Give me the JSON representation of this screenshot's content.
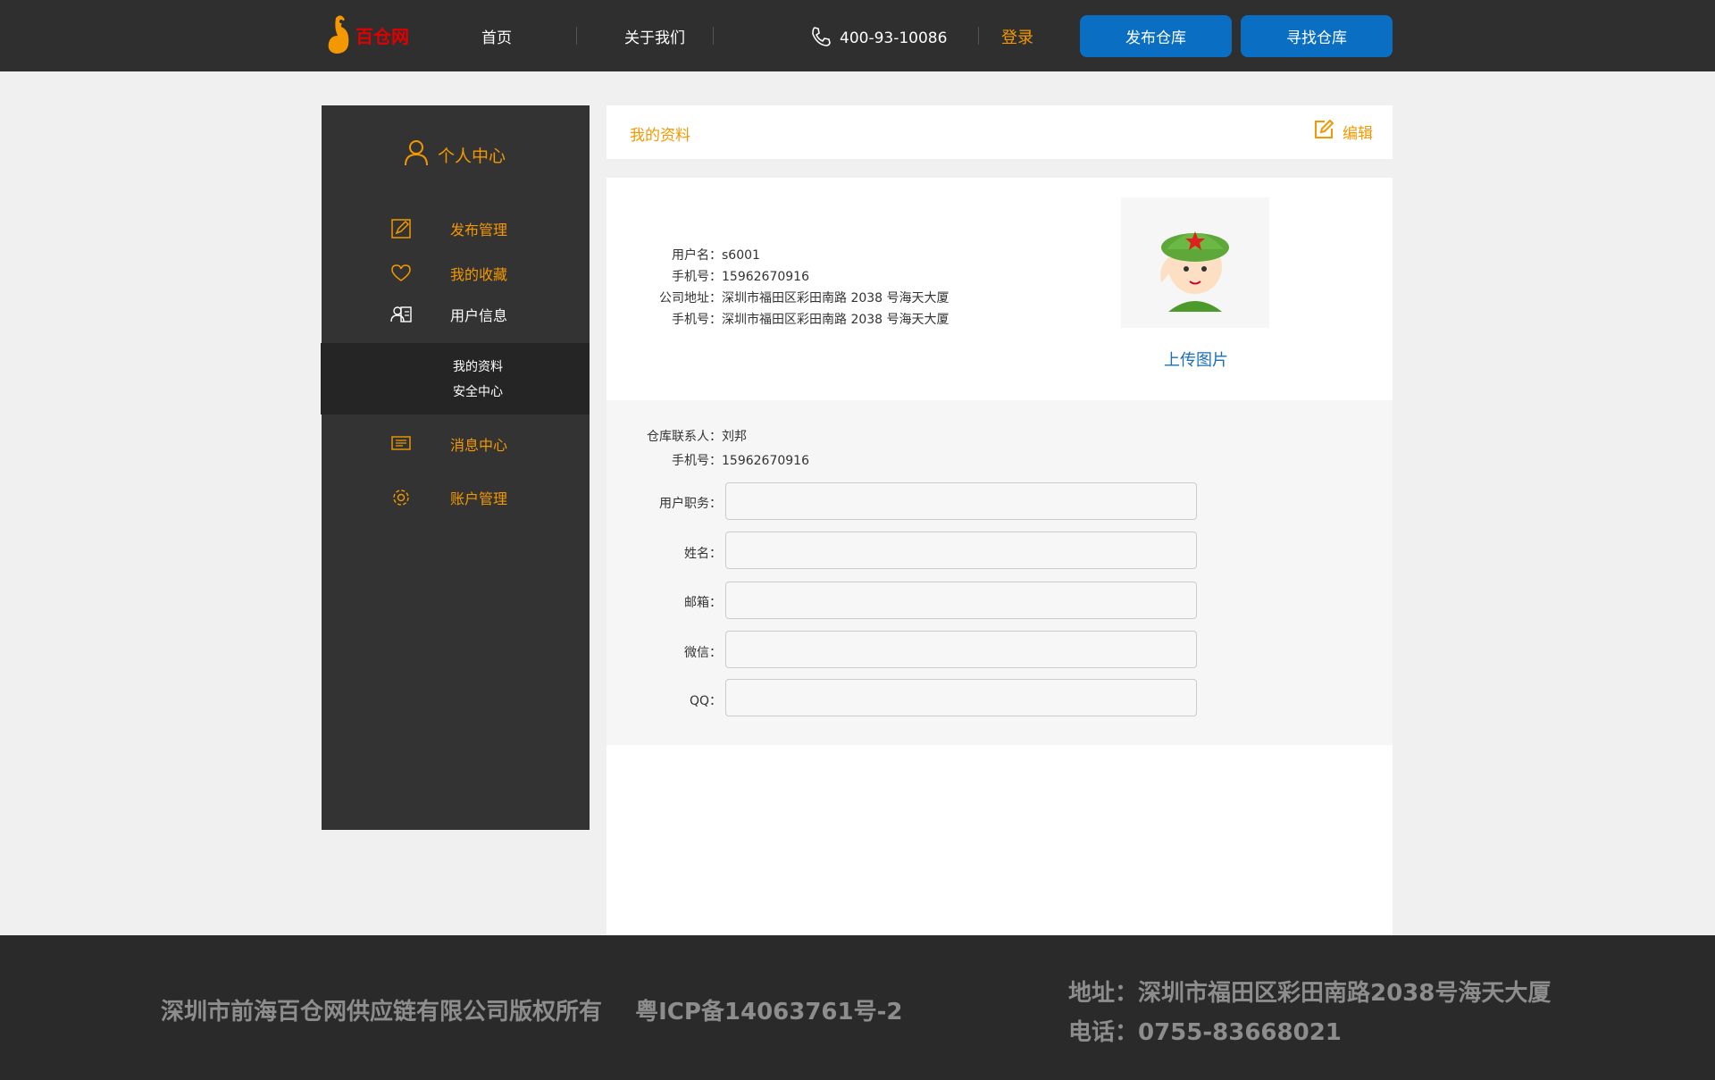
{
  "header": {
    "logo_text": "百仓网",
    "nav": [
      "首页",
      "关于我们"
    ],
    "phone": "400-93-10086",
    "login": "登录",
    "publish_button": "发布仓库",
    "find_button": "寻找仓库"
  },
  "sidebar": {
    "title": "个人中心",
    "items": [
      {
        "label": "发布管理",
        "icon": "edit-icon"
      },
      {
        "label": "我的收藏",
        "icon": "heart-icon"
      },
      {
        "label": "用户信息",
        "icon": "user-card-icon"
      },
      {
        "label": "消息中心",
        "icon": "message-icon"
      },
      {
        "label": "账户管理",
        "icon": "gear-icon"
      }
    ],
    "sub_items": [
      "我的资料",
      "安全中心"
    ]
  },
  "main": {
    "title": "我的资料",
    "edit_label": "编辑",
    "profile": [
      {
        "label": "用户名：",
        "value": "s6001"
      },
      {
        "label": "手机号：",
        "value": "15962670916"
      },
      {
        "label": "公司地址：",
        "value": "深圳市福田区彩田南路 2038 号海天大厦"
      },
      {
        "label": "手机号：",
        "value": "深圳市福田区彩田南路 2038 号海天大厦"
      }
    ],
    "upload_label": "上传图片",
    "contact": [
      {
        "label": "仓库联系人：",
        "value": "刘邦"
      },
      {
        "label": "手机号：",
        "value": "15962670916"
      }
    ],
    "fields": [
      {
        "label": "用户职务：",
        "value": ""
      },
      {
        "label": "姓名：",
        "value": ""
      },
      {
        "label": "邮箱：",
        "value": ""
      },
      {
        "label": "微信：",
        "value": ""
      },
      {
        "label": "QQ：",
        "value": ""
      }
    ]
  },
  "footer": {
    "copyright": "深圳市前海百仓网供应链有限公司版权所有",
    "icp": "粤ICP备14063761号-2",
    "address": "地址：深圳市福田区彩田南路2038号海天大厦",
    "tel": "电话：0755-83668021"
  },
  "colors": {
    "accent": "#f39800",
    "button": "#0a6fc2",
    "header_bg": "#2f2f2f",
    "sidebar_bg": "#333333"
  }
}
